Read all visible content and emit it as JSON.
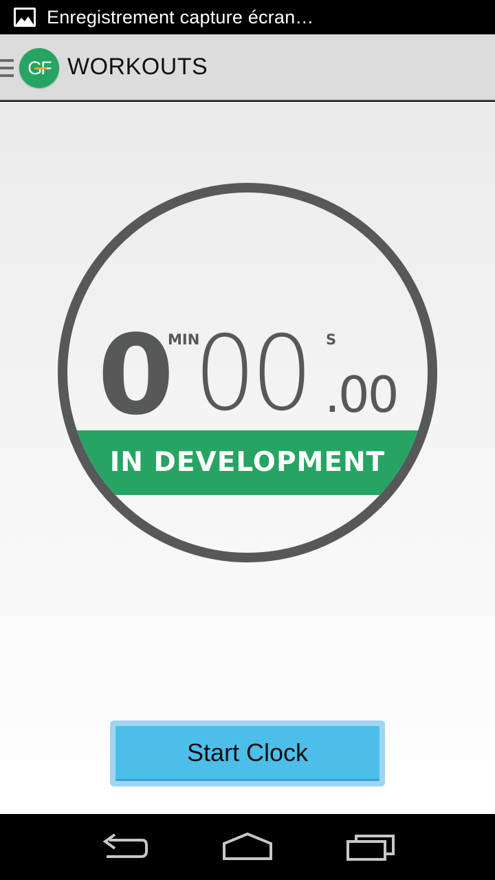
{
  "status_bar": {
    "notification_text": "Enregistrement capture écran…",
    "icon": "image-icon"
  },
  "action_bar": {
    "logo_text": "GF",
    "title": "WORKOUTS",
    "icons": [
      "drawer-icon"
    ]
  },
  "clock": {
    "minutes": "0",
    "min_label": "MIN",
    "seconds": "00",
    "sec_label": "S",
    "centiseconds": ".00",
    "status_band": "IN DEVELOPMENT"
  },
  "start_button_label": "Start Clock",
  "nav_bar": {
    "icons": [
      "back-icon",
      "home-icon",
      "recents-icon"
    ]
  },
  "colors": {
    "accent_green": "#27a463",
    "button_blue": "#4dbee9",
    "ring_gray": "#575858",
    "actionbar_bg": "#dcdcdc"
  }
}
